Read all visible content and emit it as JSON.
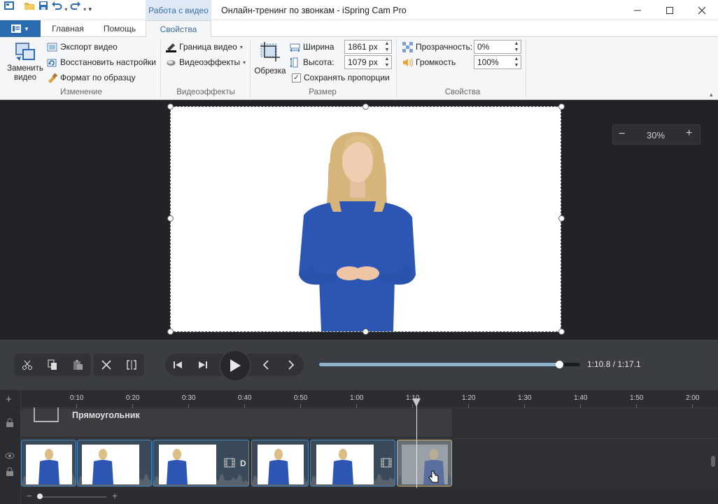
{
  "window": {
    "title": "Онлайн-тренинг по звонкам - iSpring Cam Pro",
    "context_tab_header": "Работа с видео"
  },
  "ribbon_tabs": [
    "Главная",
    "Помощь",
    "Свойства"
  ],
  "groups": {
    "change": {
      "label": "Изменение",
      "replace_video": "Заменить видео",
      "export_video": "Экспорт видео",
      "restore_settings": "Восстановить настройки",
      "format_painter": "Формат по образцу"
    },
    "effects": {
      "label": "Видеоэффекты",
      "video_border": "Граница видео",
      "video_effects": "Видеоэффекты"
    },
    "size": {
      "label": "Размер",
      "crop": "Обрезка",
      "width_label": "Ширина",
      "width_value": "1861 px",
      "height_label": "Высота:",
      "height_value": "1079 px",
      "keep_proportions": "Сохранять пропорции",
      "keep_proportions_checked": true
    },
    "properties": {
      "label": "Свойства",
      "transparency_label": "Прозрачность:",
      "transparency_value": "0%",
      "volume_label": "Громкость",
      "volume_value": "100%"
    }
  },
  "preview": {
    "zoom": "30%"
  },
  "transport": {
    "time": "1:10.8 / 1:17.1",
    "progress_fraction": 0.92
  },
  "timeline": {
    "ruler": [
      "0:10",
      "0:20",
      "0:30",
      "0:40",
      "0:50",
      "1:00",
      "1:10",
      "1:20",
      "1:30",
      "1:40",
      "1:50",
      "2:00"
    ],
    "shape_track_label": "Прямоугольник",
    "clip_partial_label": "D"
  },
  "colors": {
    "accent": "#2b6cb0",
    "video_dress": "#2d55b4",
    "clip_border": "#4a8ac0"
  }
}
